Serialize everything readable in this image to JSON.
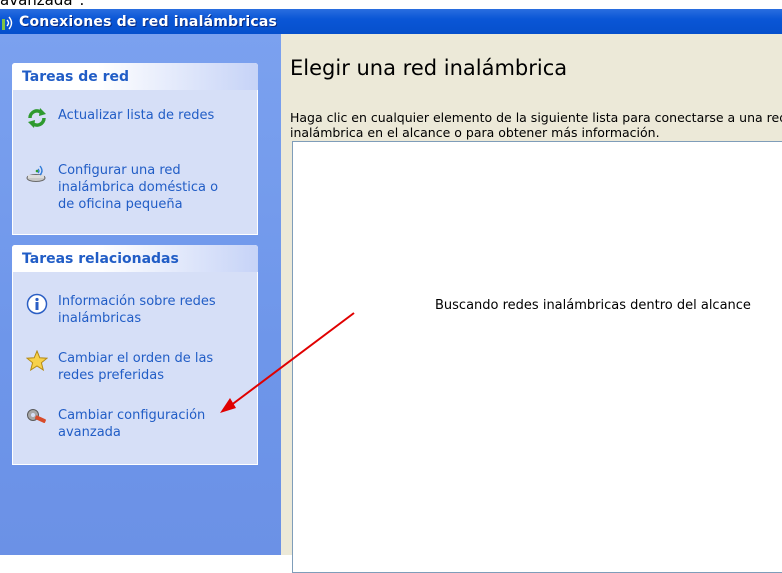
{
  "caption": "avanzada\".",
  "window": {
    "title": "Conexiones de red inalámbricas"
  },
  "sidebar": {
    "network_tasks": {
      "header": "Tareas de red",
      "items": [
        {
          "label": "Actualizar lista de redes",
          "icon": "refresh-icon"
        },
        {
          "label": "Configurar una red inalámbrica doméstica o de oficina pequeña",
          "icon": "wireless-setup-icon"
        }
      ]
    },
    "related_tasks": {
      "header": "Tareas relacionadas",
      "items": [
        {
          "label": "Información sobre redes inalámbricas",
          "icon": "info-icon"
        },
        {
          "label": "Cambiar el orden de las redes preferidas",
          "icon": "star-icon"
        },
        {
          "label": "Cambiar configuración avanzada",
          "icon": "settings-wrench-icon"
        }
      ]
    }
  },
  "main": {
    "title": "Elegir una red inalámbrica",
    "description": "Haga clic en cualquier elemento de la siguiente lista para conectarse a una red inalámbrica en el alcance o para obtener más información.",
    "status": "Buscando redes inalámbricas dentro del alcance"
  },
  "colors": {
    "titlebar": "#0a56d6",
    "sidebar_bg": "#6e96ea",
    "panel_bg": "#d6dff7",
    "link": "#215dc6",
    "annotation_arrow": "#e00000"
  }
}
